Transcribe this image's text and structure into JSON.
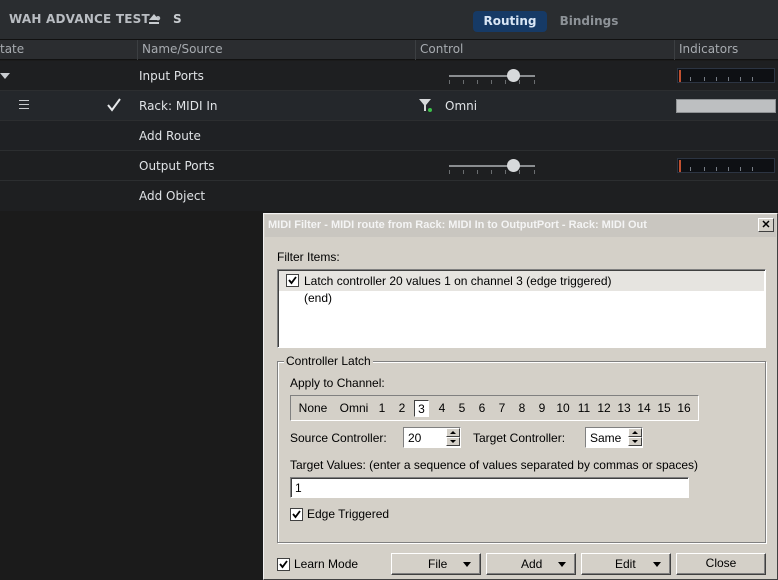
{
  "app": {
    "title": "WAH ADVANCE TEST •",
    "solo_label": "S",
    "tabs": [
      {
        "label": "Routing",
        "active": true
      },
      {
        "label": "Bindings",
        "active": false
      }
    ]
  },
  "columns": [
    "tate",
    "Name/Source",
    "Control",
    "Indicators"
  ],
  "rows": {
    "input_ports": {
      "label": "Input Ports",
      "slider_value": 0.72
    },
    "rack_midi_in": {
      "label": "Rack: MIDI In",
      "channel": "Omni"
    },
    "add_route": {
      "label": "Add Route"
    },
    "output_ports": {
      "label": "Output Ports",
      "slider_value": 0.72
    },
    "add_object": {
      "label": "Add Object"
    }
  },
  "dialog": {
    "title": "MIDI Filter - MIDI route from Rack: MIDI In to OutputPort - Rack: MIDI Out",
    "close_glyph": "✕",
    "filter_items_label": "Filter Items:",
    "filter_items": [
      {
        "text": "Latch controller 20 values 1 on channel 3 (edge triggered)",
        "checked": true
      },
      {
        "text": "(end)"
      }
    ],
    "group_label": "Controller Latch",
    "apply_channel_label": "Apply to Channel:",
    "channels": [
      "None",
      "Omni",
      "1",
      "2",
      "3",
      "4",
      "5",
      "6",
      "7",
      "8",
      "9",
      "10",
      "11",
      "12",
      "13",
      "14",
      "15",
      "16"
    ],
    "selected_channel": "3",
    "source_controller_label": "Source Controller:",
    "source_controller_value": "20",
    "target_controller_label": "Target Controller:",
    "target_controller_value": "Same",
    "target_values_label": "Target Values: (enter a sequence of values separated by commas or spaces)",
    "target_values_value": "1",
    "edge_triggered_label": "Edge Triggered",
    "edge_triggered_checked": true,
    "learn_mode_label": "Learn Mode",
    "learn_mode_checked": true,
    "buttons": {
      "file": "File",
      "add": "Add",
      "edit": "Edit",
      "close": "Close"
    }
  },
  "colors": {
    "app_background": "#1b1b1b",
    "routing_tab": "#163a66",
    "dialog_background": "#d4d0c8",
    "meter_peak": "#c05030"
  }
}
